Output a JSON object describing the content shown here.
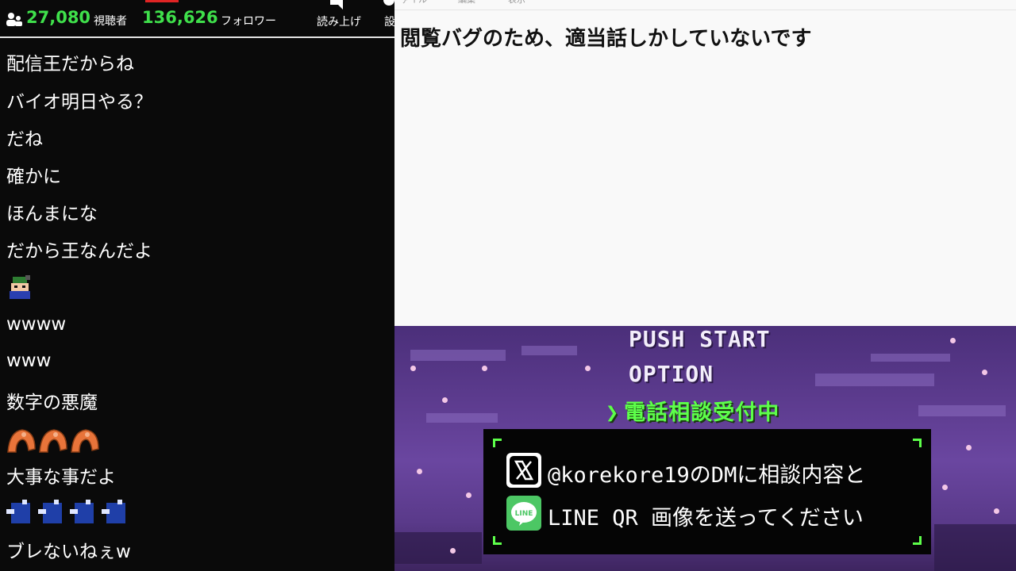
{
  "header": {
    "viewers_value": "27,080",
    "viewers_label": "視聴者",
    "followers_value": "136,626",
    "followers_label": "フォロワー",
    "read_aloud_label": "読み上げ",
    "settings_label": "設"
  },
  "chat": {
    "messages": [
      "配信王だからね",
      "バイオ明日やる？",
      "だね",
      "確かに",
      "ほんまにな",
      "だから王なんだよ",
      "wwww",
      "www",
      "数字の悪魔",
      "大事な事だよ",
      "ブレないねぇw"
    ]
  },
  "notepad": {
    "text": "閲覧バグのため、適当話しかしていないです"
  },
  "game": {
    "menu": [
      "PUSH START",
      "OPTION",
      "電話相談受付中"
    ],
    "contact_x": "@korekore19のDMに相談内容と",
    "contact_line": "LINE QR 画像を送ってください",
    "line_badge": "LINE"
  },
  "colors": {
    "accent_green": "#3fe04b",
    "game_green": "#5dff4a",
    "chat_bg": "#0a0a0a"
  }
}
